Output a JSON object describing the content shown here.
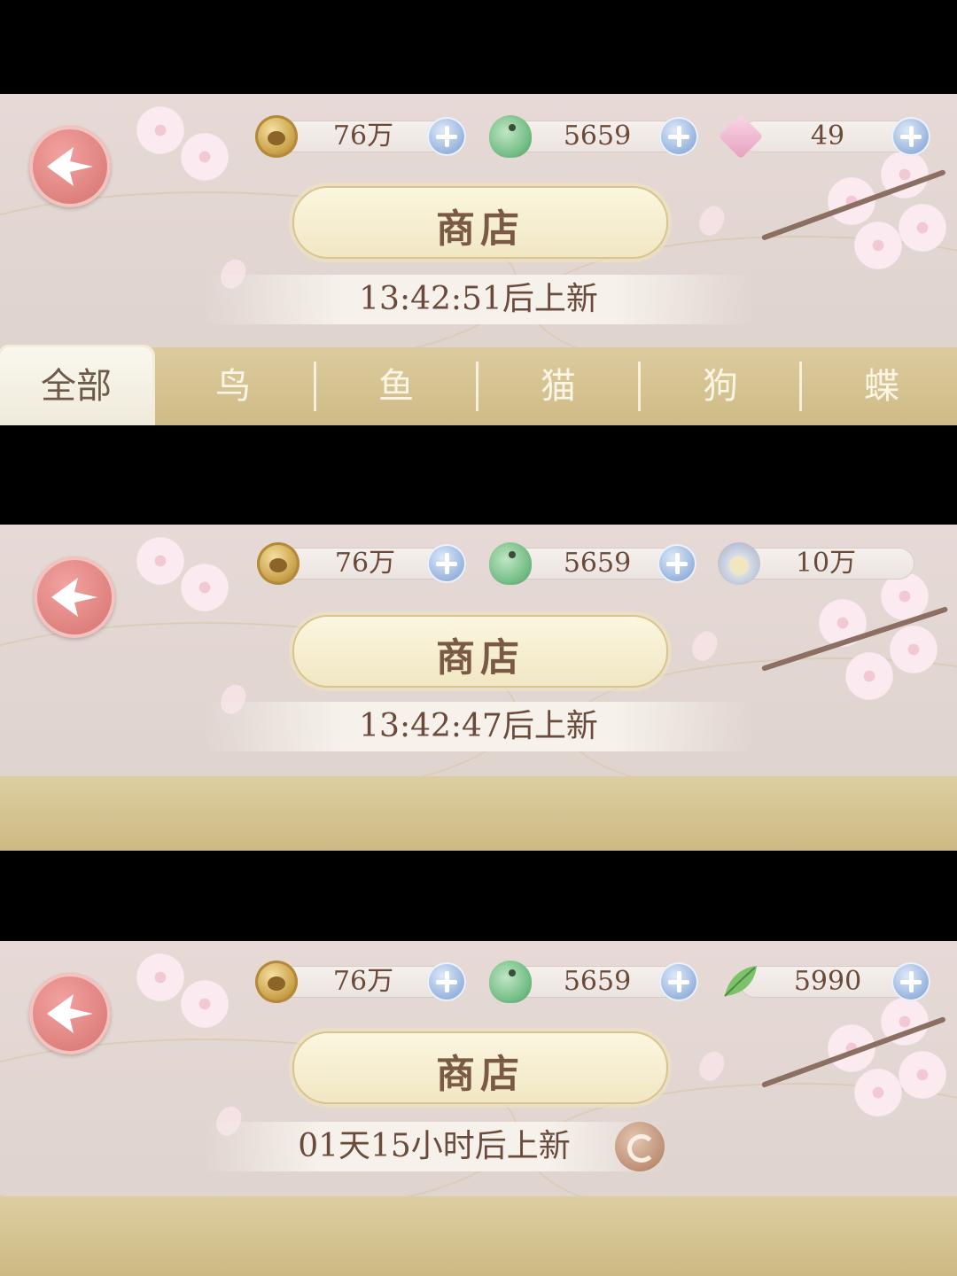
{
  "panels": [
    {
      "resources": [
        {
          "icon": "paw-coin-icon",
          "value": "76万"
        },
        {
          "icon": "parrot-icon",
          "value": "5659"
        },
        {
          "icon": "pink-gem-icon",
          "value": "49"
        }
      ],
      "title": "商店",
      "timer": "13:42:51后上新",
      "tabs": [
        "全部",
        "鸟",
        "鱼",
        "猫",
        "狗",
        "蝶"
      ],
      "active_tab": "全部"
    },
    {
      "resources": [
        {
          "icon": "paw-coin-icon",
          "value": "76万"
        },
        {
          "icon": "parrot-icon",
          "value": "5659"
        },
        {
          "icon": "shell-icon",
          "value": "10万"
        }
      ],
      "title": "商店",
      "timer": "13:42:47后上新"
    },
    {
      "resources": [
        {
          "icon": "paw-coin-icon",
          "value": "76万"
        },
        {
          "icon": "parrot-icon",
          "value": "5659"
        },
        {
          "icon": "leaf-icon",
          "value": "5990"
        }
      ],
      "title": "商店",
      "timer": "01天15小时后上新"
    }
  ]
}
